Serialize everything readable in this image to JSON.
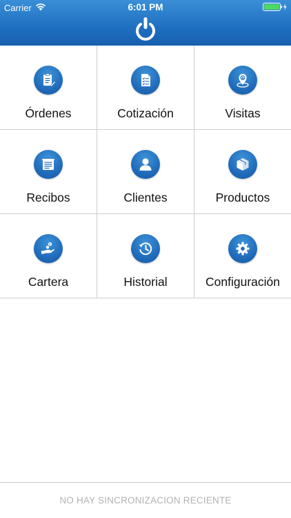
{
  "status_bar": {
    "carrier": "Carrier",
    "time": "6:01 PM"
  },
  "header": {
    "logo_icon": "power-logo-icon",
    "background_color": "#1f6fc0"
  },
  "menu": {
    "items": [
      {
        "label": "Órdenes",
        "icon": "clipboard-pen-icon"
      },
      {
        "label": "Cotización",
        "icon": "checklist-document-icon"
      },
      {
        "label": "Visitas",
        "icon": "location-pin-icon"
      },
      {
        "label": "Recibos",
        "icon": "receipt-icon"
      },
      {
        "label": "Clientes",
        "icon": "user-icon"
      },
      {
        "label": "Productos",
        "icon": "package-box-icon"
      },
      {
        "label": "Cartera",
        "icon": "hand-money-icon"
      },
      {
        "label": "Historial",
        "icon": "history-clock-icon"
      },
      {
        "label": "Configuración",
        "icon": "gear-icon"
      }
    ]
  },
  "footer": {
    "sync_status": "NO HAY SINCRONIZACION RECIENTE"
  }
}
